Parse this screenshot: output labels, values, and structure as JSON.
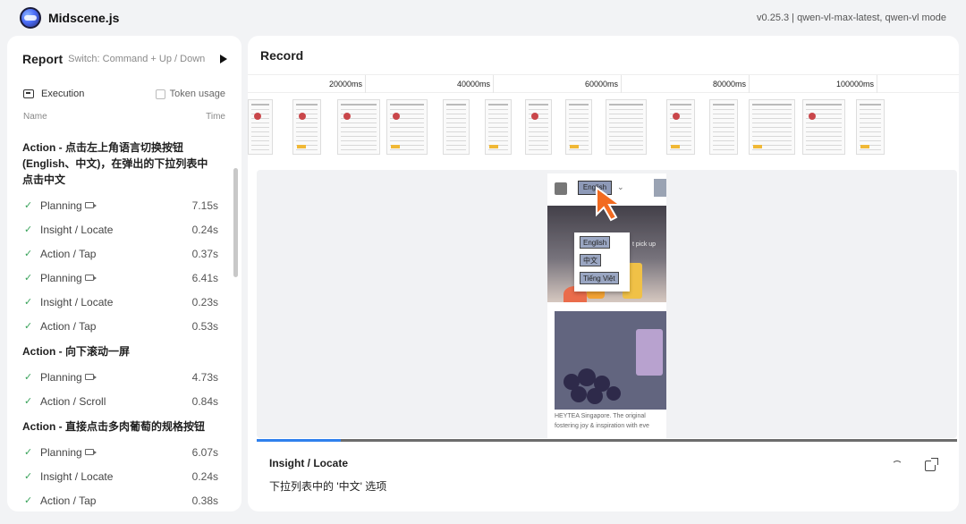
{
  "app": {
    "title": "Midscene.js",
    "version": "v0.25.3 | qwen-vl-max-latest, qwen-vl mode"
  },
  "report": {
    "title": "Report",
    "switch_hint": "Switch: Command + Up / Down",
    "execution_label": "Execution",
    "token_usage_label": "Token usage",
    "col_name": "Name",
    "col_time": "Time",
    "groups": [
      {
        "title": "Action - 点击左上角语言切换按钮(English、中文)，在弹出的下拉列表中点击中文",
        "tasks": [
          {
            "label": "Planning",
            "time": "7.15s",
            "has_video_icon": true
          },
          {
            "label": "Insight / Locate",
            "time": "0.24s",
            "has_video_icon": false
          },
          {
            "label": "Action / Tap",
            "time": "0.37s",
            "has_video_icon": false
          },
          {
            "label": "Planning",
            "time": "6.41s",
            "has_video_icon": true
          },
          {
            "label": "Insight / Locate",
            "time": "0.23s",
            "has_video_icon": false
          },
          {
            "label": "Action / Tap",
            "time": "0.53s",
            "has_video_icon": false
          }
        ]
      },
      {
        "title": "Action - 向下滚动一屏",
        "tasks": [
          {
            "label": "Planning",
            "time": "4.73s",
            "has_video_icon": true
          },
          {
            "label": "Action / Scroll",
            "time": "0.84s",
            "has_video_icon": false
          }
        ]
      },
      {
        "title": "Action - 直接点击多肉葡萄的规格按钮",
        "tasks": [
          {
            "label": "Planning",
            "time": "6.07s",
            "has_video_icon": true
          },
          {
            "label": "Insight / Locate",
            "time": "0.24s",
            "has_video_icon": false
          },
          {
            "label": "Action / Tap",
            "time": "0.38s",
            "has_video_icon": false
          }
        ]
      }
    ]
  },
  "record": {
    "title": "Record",
    "ticks": [
      "20000ms",
      "40000ms",
      "60000ms",
      "80000ms",
      "100000ms"
    ],
    "preview": {
      "lang_button": "English",
      "dropdown_items": [
        "English",
        "中文",
        "Tiếng Việt"
      ],
      "banner_text": "t pick up",
      "caption": "HEYTEA Singapore. The original fostering joy & inspiration with eve"
    },
    "progress_percent": 12,
    "detail_title": "Insight / Locate",
    "detail_desc": "下拉列表中的 '中文' 选项"
  },
  "colors": {
    "accent": "#2f80ed",
    "success": "#3aa35b",
    "cursor": "#f26b21"
  }
}
